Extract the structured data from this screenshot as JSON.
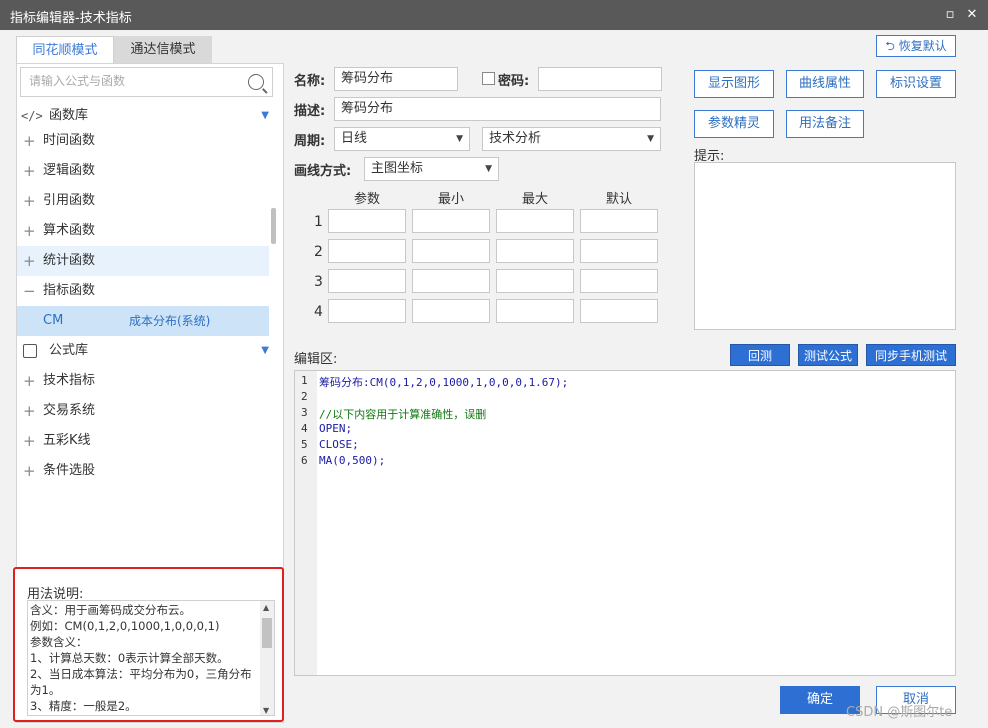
{
  "window": {
    "title": "指标编辑器-技术指标"
  },
  "tabs": [
    {
      "label": "同花顺模式"
    },
    {
      "label": "通达信模式"
    }
  ],
  "restore_button": "恢复默认",
  "search": {
    "placeholder": "请输入公式与函数"
  },
  "tree": {
    "func_lib_label": "函数库",
    "func_items": [
      "时间函数",
      "逻辑函数",
      "引用函数",
      "算术函数",
      "统计函数",
      "指标函数"
    ],
    "selected_row": {
      "code": "CM",
      "name": "成本分布(系统)"
    },
    "formula_lib_label": "公式库",
    "formula_items": [
      "技术指标",
      "交易系统",
      "五彩K线",
      "条件选股"
    ]
  },
  "usage": {
    "label": "用法说明:",
    "lines": [
      "含义：用于画筹码成交分布云。",
      "例如：CM(0,1,2,0,1000,1,0,0,0,1)",
      "参数含义：",
      "1、计算总天数：0表示计算全部天数。",
      "2、当日成本算法：平均分布为0，三角分布",
      "为1。",
      "3、精度：一般是2。"
    ]
  },
  "form": {
    "name_label": "名称:",
    "name_value": "筹码分布",
    "password_label": "密码:",
    "desc_label": "描述:",
    "desc_value": "筹码分布",
    "period_label": "周期:",
    "period_value": "日线",
    "category_value": "技术分析",
    "draw_label": "画线方式:",
    "draw_value": "主图坐标"
  },
  "params": {
    "headers": [
      "参数",
      "最小",
      "最大",
      "默认"
    ],
    "rows": [
      "1",
      "2",
      "3",
      "4"
    ]
  },
  "right_buttons": [
    "显示图形",
    "曲线属性",
    "标识设置",
    "参数精灵",
    "用法备注"
  ],
  "hint_label": "提示:",
  "editor": {
    "label": "编辑区:",
    "buttons": [
      "回测",
      "测试公式",
      "同步手机测试"
    ],
    "lines": [
      {
        "n": "1",
        "text": "筹码分布:CM(0,1,2,0,1000,1,0,0,0,1.67);"
      },
      {
        "n": "2",
        "text": ""
      },
      {
        "n": "3",
        "text": "//以下内容用于计算准确性，误删"
      },
      {
        "n": "4",
        "text": "OPEN;"
      },
      {
        "n": "5",
        "text": "CLOSE;"
      },
      {
        "n": "6",
        "text": "MA(0,500);"
      }
    ]
  },
  "footer": {
    "ok": "确定",
    "cancel": "取消"
  },
  "watermark": "CSDN @斯图尔te"
}
